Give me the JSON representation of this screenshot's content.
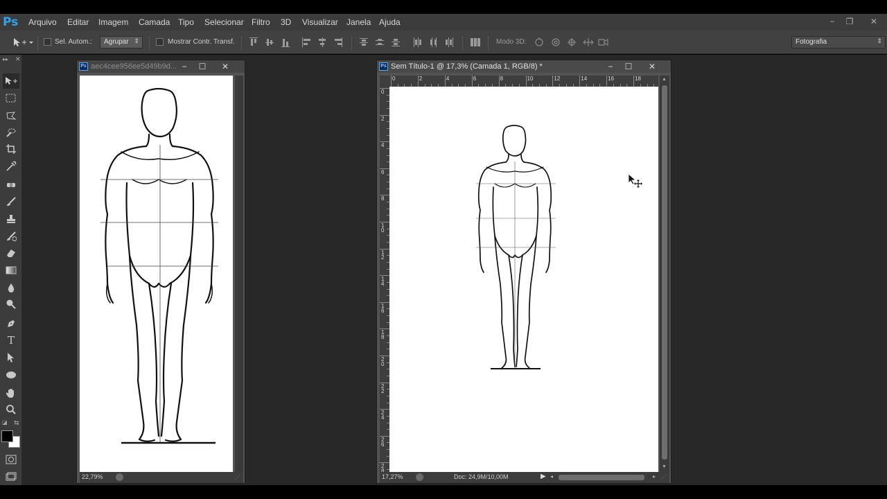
{
  "app": {
    "logo": "Ps"
  },
  "menu": [
    "Arquivo",
    "Editar",
    "Imagem",
    "Camada",
    "Tipo",
    "Selecionar",
    "Filtro",
    "3D",
    "Visualizar",
    "Janela",
    "Ajuda"
  ],
  "window_controls": {
    "minimize": "−",
    "restore": "❐",
    "close": "✕"
  },
  "options": {
    "auto_select_label": "Sel. Autom.:",
    "group_select": "Agrupar",
    "show_transform_label": "Mostrar Contr. Transf.",
    "mode3d_label": "Modo 3D:",
    "workspace_select": "Fotografia"
  },
  "doc_left": {
    "badge": "Ps",
    "title": "aec4cee956ee5d49b9d...",
    "zoom": "22,79%"
  },
  "doc_right": {
    "badge": "Ps",
    "title": "Sem Título-1 @ 17,3% (Camada 1, RGB/8) *",
    "zoom": "17,27%",
    "doc_info": "Doc: 24,9M/10,00M",
    "ruler_h": [
      "0",
      "2",
      "4",
      "6",
      "8",
      "10",
      "12",
      "14",
      "16",
      "18"
    ],
    "ruler_v": [
      "0",
      "2",
      "4",
      "6",
      "8",
      "1 0",
      "1 2",
      "1 4",
      "1 6",
      "1 8",
      "2 0",
      "2 2",
      "2 4",
      "2 6",
      "2 8"
    ]
  },
  "colors": {
    "accent": "#2fa3e8",
    "menubar": "#3c3c3c",
    "workspace": "#282828"
  }
}
